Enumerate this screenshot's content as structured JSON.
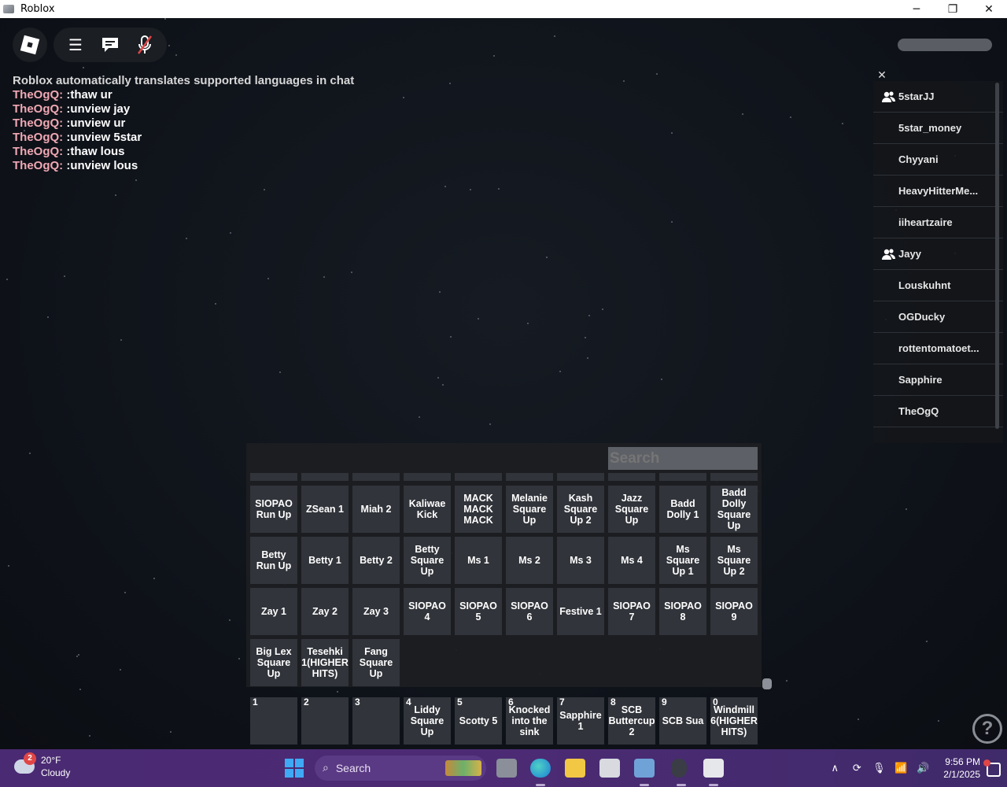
{
  "window": {
    "title": "Roblox",
    "controls": {
      "minimize": "─",
      "maximize": "❐",
      "close": "✕"
    }
  },
  "icons": {
    "menu": "☰",
    "chat": "💬",
    "mic_muted": "🎤",
    "close": "✕",
    "friend": "friend-icon",
    "help": "?"
  },
  "chat": {
    "system_line": "Roblox automatically translates supported languages in chat",
    "messages": [
      {
        "user": "TheOgQ:",
        "text": ":thaw ur"
      },
      {
        "user": "TheOgQ:",
        "text": ":unview jay"
      },
      {
        "user": "TheOgQ:",
        "text": ":unview ur"
      },
      {
        "user": "TheOgQ:",
        "text": ":unview 5star"
      },
      {
        "user": "TheOgQ:",
        "text": ":thaw lous"
      },
      {
        "user": "TheOgQ:",
        "text": ":unview lous"
      }
    ]
  },
  "player_list": {
    "players": [
      {
        "name": "5starJJ",
        "friend": true
      },
      {
        "name": "5star_money",
        "friend": false
      },
      {
        "name": "Chyyani",
        "friend": false
      },
      {
        "name": "HeavyHitterMe...",
        "friend": false
      },
      {
        "name": "iiheartzaire",
        "friend": false
      },
      {
        "name": "Jayy",
        "friend": true
      },
      {
        "name": "Louskuhnt",
        "friend": false
      },
      {
        "name": "OGDucky",
        "friend": false
      },
      {
        "name": "rottentomatoet...",
        "friend": false
      },
      {
        "name": "Sapphire",
        "friend": false
      },
      {
        "name": "TheOgQ",
        "friend": false
      }
    ]
  },
  "emotes": {
    "search_placeholder": "Search",
    "rows": [
      [
        "SIOPAO Run Up",
        "ZSean 1",
        "Miah 2",
        "Kaliwae Kick",
        "MACK MACK MACK",
        "Melanie Square Up",
        "Kash Square Up 2",
        "Jazz Square Up",
        "Badd Dolly 1",
        "Badd Dolly Square Up"
      ],
      [
        "Betty Run Up",
        "Betty 1",
        "Betty 2",
        "Betty Square Up",
        "Ms 1",
        "Ms 2",
        "Ms 3",
        "Ms 4",
        "Ms Square Up 1",
        "Ms Square Up 2"
      ],
      [
        "Zay 1",
        "Zay 2",
        "Zay 3",
        "SIOPAO 4",
        "SIOPAO 5",
        "SIOPAO 6",
        "Festive 1",
        "SIOPAO 7",
        "SIOPAO 8",
        "SIOPAO 9"
      ],
      [
        "Big Lex Square Up",
        "Tesehki 1(HIGHER HITS)",
        "Fang Square Up"
      ]
    ]
  },
  "hotbar": [
    {
      "key": "1",
      "label": ""
    },
    {
      "key": "2",
      "label": ""
    },
    {
      "key": "3",
      "label": ""
    },
    {
      "key": "4",
      "label": "Liddy Square Up"
    },
    {
      "key": "5",
      "label": "Scotty 5"
    },
    {
      "key": "6",
      "label": "Knocked into the sink"
    },
    {
      "key": "7",
      "label": "Sapphire 1"
    },
    {
      "key": "8",
      "label": "SCB Buttercup 2"
    },
    {
      "key": "9",
      "label": "SCB Sua"
    },
    {
      "key": "0",
      "label": "Windmill 6(HIGHER HITS)"
    }
  ],
  "taskbar": {
    "weather": {
      "badge": "2",
      "temp": "20°F",
      "condition": "Cloudy"
    },
    "search_label": "Search",
    "search_icon": "⌕",
    "tray": {
      "chevron": "∧",
      "sync": "⟳",
      "mic": "🎙",
      "wifi": "📶",
      "volume": "🔊"
    },
    "time": "9:56 PM",
    "date": "2/1/2025"
  },
  "colors": {
    "chat_username": "#f0a8b4",
    "taskbar": "#4a2a72",
    "tile": "#31343a",
    "search_box": "#5d6066"
  }
}
